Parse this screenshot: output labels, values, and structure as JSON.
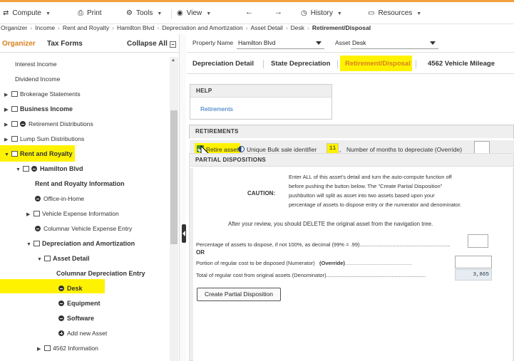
{
  "toolbar": {
    "compute": "Compute",
    "print": "Print",
    "tools": "Tools",
    "view": "View",
    "history": "History",
    "resources": "Resources"
  },
  "breadcrumb": [
    "Organizer",
    "Income",
    "Rent and Royalty",
    "Hamilton Blvd",
    "Depreciation and Amortization",
    "Asset Detail",
    "Desk",
    "Retirement/Disposal"
  ],
  "left": {
    "tab_organizer": "Organizer",
    "tab_tax_forms": "Tax Forms",
    "collapse_all": "Collapse All",
    "tree": [
      {
        "label": "Interest Income"
      },
      {
        "label": "Dividend Income"
      },
      {
        "label": "Brokerage Statements"
      },
      {
        "label": "Business Income"
      },
      {
        "label": "Retirement Distributions"
      },
      {
        "label": "Lump Sum Distributions"
      },
      {
        "label": "Rent and Royalty"
      },
      {
        "label": "Hamilton Blvd"
      },
      {
        "label": "Rent and Royalty Information"
      },
      {
        "label": "Office-in-Home"
      },
      {
        "label": "Vehicle Expense Information"
      },
      {
        "label": "Columnar Vehicle Expense Entry"
      },
      {
        "label": "Depreciation and Amortization"
      },
      {
        "label": "Asset Detail"
      },
      {
        "label": "Columnar Depreciation Entry"
      },
      {
        "label": "Desk"
      },
      {
        "label": "Equipment"
      },
      {
        "label": "Software"
      },
      {
        "label": "Add new Asset"
      },
      {
        "label": "4562 Information"
      }
    ]
  },
  "selectors": {
    "property_label": "Property Name",
    "property_value": "Hamilton Blvd",
    "asset_label": "Asset",
    "asset_value": "Desk"
  },
  "tabs": [
    "Depreciation Detail",
    "State Depreciation",
    "Retirement/Disposal",
    "4562 Vehicle Mileage"
  ],
  "help": {
    "title": "HELP",
    "link": "Retirements"
  },
  "retirements": {
    "title": "RETIREMENTS",
    "retire_label": "Retire asset",
    "bulk_label": "Unique Bulk sale identifier",
    "bulk_value": "11",
    "months_label": "Number of months to depreciate (Override)"
  },
  "partial": {
    "title": "PARTIAL DISPOSITIONS",
    "caution_label": "CAUTION:",
    "caution_lines": [
      "Enter ALL of this asset's detail and turn the auto-compute function off",
      "before pushing the button below. The \"Create Partial Disposition\"",
      "pushbutton will split as asset into two assets based upon your",
      "percentage of assets to dispose entry or the numerator and denominator."
    ],
    "after_review": "After your review, you should DELETE the original asset from the navigation tree.",
    "percentage_label": "Percentage of assets to dispose, if not 100%, as decimal (99% = .99).............................................................",
    "or_label": "OR",
    "portion_label": "Portion of regular cost to be disposed (Numerator)",
    "portion_override": "(Override)",
    "portion_dots": ".............................................",
    "total_label": "Total of regular cost from original assets (Denominator)...................................................................",
    "total_value": "3,865",
    "button": "Create Partial Disposition"
  },
  "colors": {
    "accent": "#d9801e",
    "highlight": "#fff200",
    "checkbox": "#4a8a3a"
  }
}
